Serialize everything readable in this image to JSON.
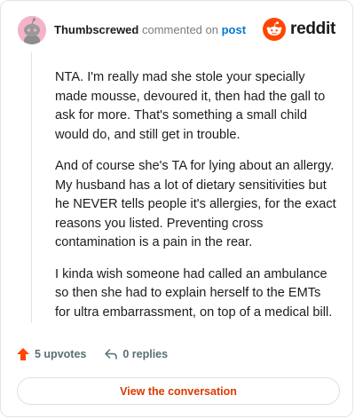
{
  "header": {
    "author": "Thumbscrewed",
    "action": "commented on",
    "post_link": "post",
    "logo_text": "reddit"
  },
  "comment": {
    "paragraphs": [
      "NTA. I'm really mad she stole your specially made mousse, devoured it, then had the gall to ask for more. That's something a small child would do, and still get in trouble.",
      "And of course she's TA for lying about an allergy. My husband has a lot of dietary sensitivities but he NEVER tells people it's allergies, for the exact reasons you listed. Preventing cross contamination is a pain in the rear.",
      "I kinda wish someone had called an ambulance so then she had to explain herself to the EMTs for ultra embarrassment, on top of a medical bill."
    ]
  },
  "actions": {
    "upvotes": "5 upvotes",
    "replies": "0 replies"
  },
  "cta_label": "View the conversation",
  "colors": {
    "brand": "#ff4500",
    "link": "#0079d3",
    "cta": "#d93a00",
    "avatar_bg": "#f5b3cb"
  },
  "icons": {
    "avatar": "snoo-avatar-icon",
    "logo": "reddit-snoo-icon",
    "upvote": "upvote-arrow-icon",
    "reply": "reply-arrow-icon"
  }
}
